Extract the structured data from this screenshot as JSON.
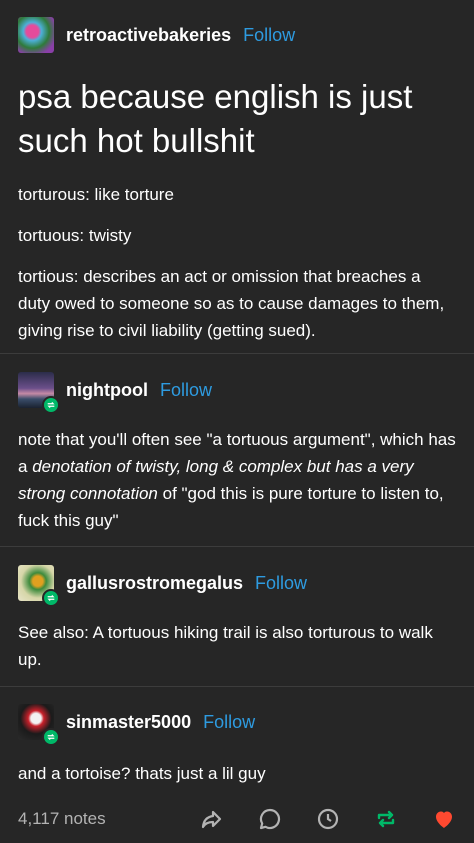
{
  "op": {
    "username": "retroactivebakeries",
    "follow_label": "Follow",
    "title": "psa because english is just such hot bullshit",
    "paragraphs": [
      "torturous: like torture",
      "tortuous: twisty",
      "tortious: describes an act or omission that breaches a duty owed to someone so as to cause damages to them, giving rise to civil liability (getting sued)."
    ]
  },
  "reblogs": [
    {
      "username": "nightpool",
      "follow_label": "Follow",
      "text_pre": "note that you'll often see \"a tortuous argument\", which has a ",
      "text_em": "denotation of twisty, long & complex but has a very strong connotation",
      "text_post": " of \"god this is pure torture to listen to, fuck this guy\""
    },
    {
      "username": "gallusrostromegalus",
      "follow_label": "Follow",
      "text": "See also: A tortuous hiking trail is also torturous to walk up."
    },
    {
      "username": "sinmaster5000",
      "follow_label": "Follow",
      "text": "and a tortoise? thats just a lil guy"
    }
  ],
  "footer": {
    "notes": "4,117 notes",
    "icons": [
      "share-icon",
      "reply-icon",
      "history-icon",
      "reblog-icon",
      "like-icon"
    ]
  },
  "colors": {
    "background": "#262626",
    "follow": "#2e9be0",
    "reblog": "#00b868",
    "like": "#ff4930"
  }
}
